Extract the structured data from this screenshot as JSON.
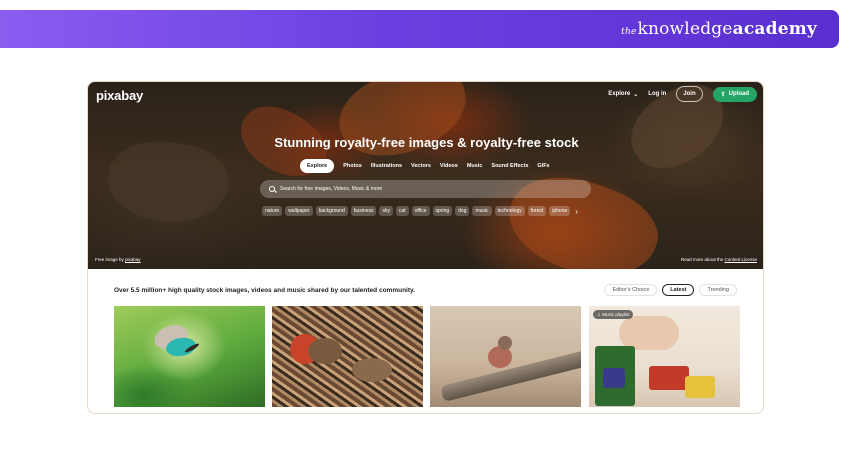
{
  "banner": {
    "brand_prefix": "the",
    "brand_main": "knowledge",
    "brand_bold": "academy"
  },
  "site": {
    "logo": "pixabay",
    "nav": {
      "explore": "Explore",
      "login": "Log in",
      "join": "Join",
      "upload": "Upload"
    },
    "headline": "Stunning royalty-free images & royalty-free stock",
    "tabs": [
      "Explore",
      "Photos",
      "Illustrations",
      "Vectors",
      "Videos",
      "Music",
      "Sound Effects",
      "GIFs"
    ],
    "search": {
      "placeholder": "Search for free Images, Videos, Music & more"
    },
    "tags": [
      "nature",
      "wallpaper",
      "background",
      "business",
      "sky",
      "cat",
      "office",
      "spring",
      "dog",
      "music",
      "technology",
      "forest",
      "iphone"
    ],
    "credit": {
      "prefix": "Free image by",
      "author": "pixabay"
    },
    "license": {
      "prefix": "Read more about the",
      "link": "Content License"
    },
    "tagline": "Over 5.5 million+ high quality stock images, videos and music shared by our talented community.",
    "filters": [
      "Editor's Choice",
      "Latest",
      "Trending"
    ],
    "music_badge": "Music playlist"
  },
  "colors": {
    "banner": "#6d3fe0",
    "upload": "#23a566",
    "frame_border": "#e6d8c8"
  }
}
